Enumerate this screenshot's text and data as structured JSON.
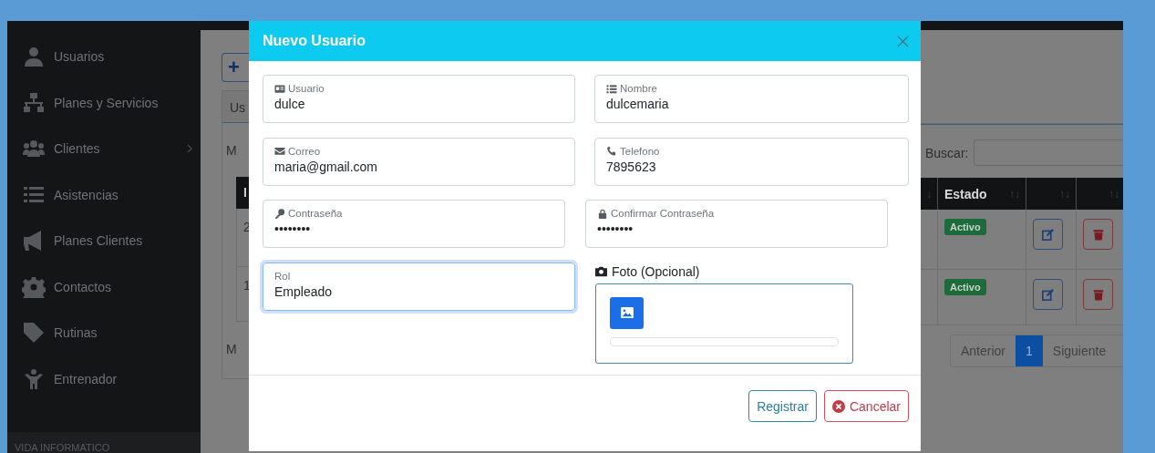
{
  "sidebar": {
    "items": [
      {
        "label": "Usuarios",
        "submenu": false
      },
      {
        "label": "Planes y Servicios",
        "submenu": false
      },
      {
        "label": "Clientes",
        "submenu": true
      },
      {
        "label": "Asistencias",
        "submenu": false
      },
      {
        "label": "Planes Clientes",
        "submenu": false
      },
      {
        "label": "Contactos",
        "submenu": false
      },
      {
        "label": "Rutinas",
        "submenu": false
      },
      {
        "label": "Entrenador",
        "submenu": false
      }
    ],
    "footer": "VIDA INFORMATICO"
  },
  "content": {
    "add_button": "+",
    "tab": "Us",
    "length_label": "M",
    "search_label": "Buscar:",
    "table": {
      "columns": [
        {
          "label": "I"
        },
        {
          "sort": "↓"
        },
        {
          "label": "Estado",
          "sort": "↑↓"
        },
        {
          "sort": "↑↓"
        },
        {
          "sort": "↑↓"
        }
      ],
      "rows": [
        {
          "cell": "2",
          "status": "Activo"
        },
        {
          "cell": "1",
          "status": "Activo"
        }
      ]
    },
    "info_label": "M",
    "pagination": [
      {
        "label": "Anterior",
        "selected": false
      },
      {
        "label": "1",
        "selected": true
      },
      {
        "label": "Siguiente",
        "selected": false
      }
    ]
  },
  "modal": {
    "title": "Nuevo Usuario",
    "fields": [
      {
        "label": "Usuario",
        "value": "dulce",
        "focused": false
      },
      {
        "label": "Nombre",
        "value": "dulcemaria",
        "focused": false
      },
      {
        "label": "Correo",
        "value": "maria@gmail.com",
        "focused": false
      },
      {
        "label": "Telefono",
        "value": "7895623",
        "focused": false
      },
      {
        "label": "Contraseña",
        "value": "••••••••",
        "focused": false
      },
      {
        "label": "Confirmar Contraseña",
        "value": "••••••••",
        "focused": false
      },
      {
        "label": "Rol",
        "value": "Empleado",
        "focused": true
      }
    ],
    "photo": {
      "label": "Foto (Opcional)",
      "level": 0
    },
    "buttons": [
      {
        "label": "Registrar",
        "kind": "submit"
      },
      {
        "label": "Cancelar",
        "kind": "cancel"
      }
    ]
  }
}
